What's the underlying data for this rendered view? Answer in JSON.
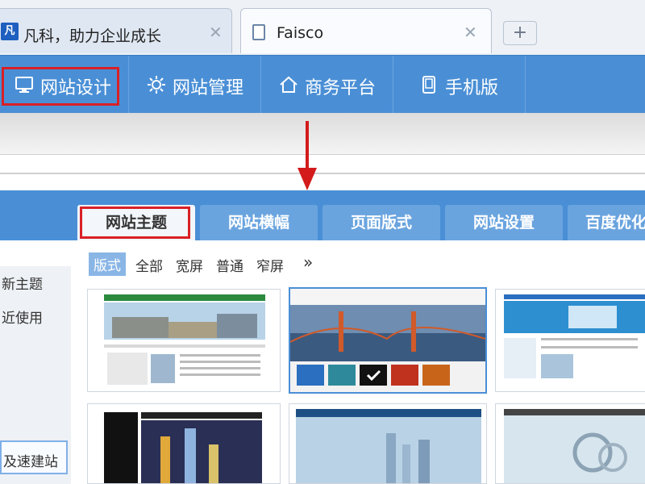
{
  "browser": {
    "tabs": [
      {
        "label": "凡科，助力企业成长",
        "favicon": "fanke-logo-icon",
        "favicon_text": "凡"
      },
      {
        "label": "Faisco",
        "favicon": "document-icon"
      }
    ],
    "close_glyph": "✕",
    "new_tab_glyph": "+"
  },
  "top_nav": {
    "items": [
      {
        "label": "网站设计",
        "icon": "monitor-icon"
      },
      {
        "label": "网站管理",
        "icon": "gear-icon"
      },
      {
        "label": "商务平台",
        "icon": "home-icon"
      },
      {
        "label": "手机版",
        "icon": "phone-icon"
      }
    ],
    "highlighted_index": 0
  },
  "panel_tabs": {
    "items": [
      "网站主题",
      "网站横幅",
      "页面版式",
      "网站设置",
      "百度优化"
    ],
    "highlighted_index": 0
  },
  "left_menu": {
    "items": [
      "新主题",
      "近使用",
      "及速建站"
    ]
  },
  "filter": {
    "label": "版式",
    "options": [
      "全部",
      "宽屏",
      "普通",
      "窄屏"
    ],
    "more": "»"
  },
  "colors": {
    "nav_blue": "#4a8fd6",
    "highlight_red": "#d92026",
    "swatches": [
      "#2a6fc0",
      "#2e8a9a",
      "#111111",
      "#c0321e",
      "#c8641a"
    ]
  },
  "template_cards": [
    {
      "name": "theme-1"
    },
    {
      "name": "theme-2",
      "selected": true
    },
    {
      "name": "theme-3"
    },
    {
      "name": "theme-4"
    },
    {
      "name": "theme-5"
    },
    {
      "name": "theme-6"
    }
  ]
}
